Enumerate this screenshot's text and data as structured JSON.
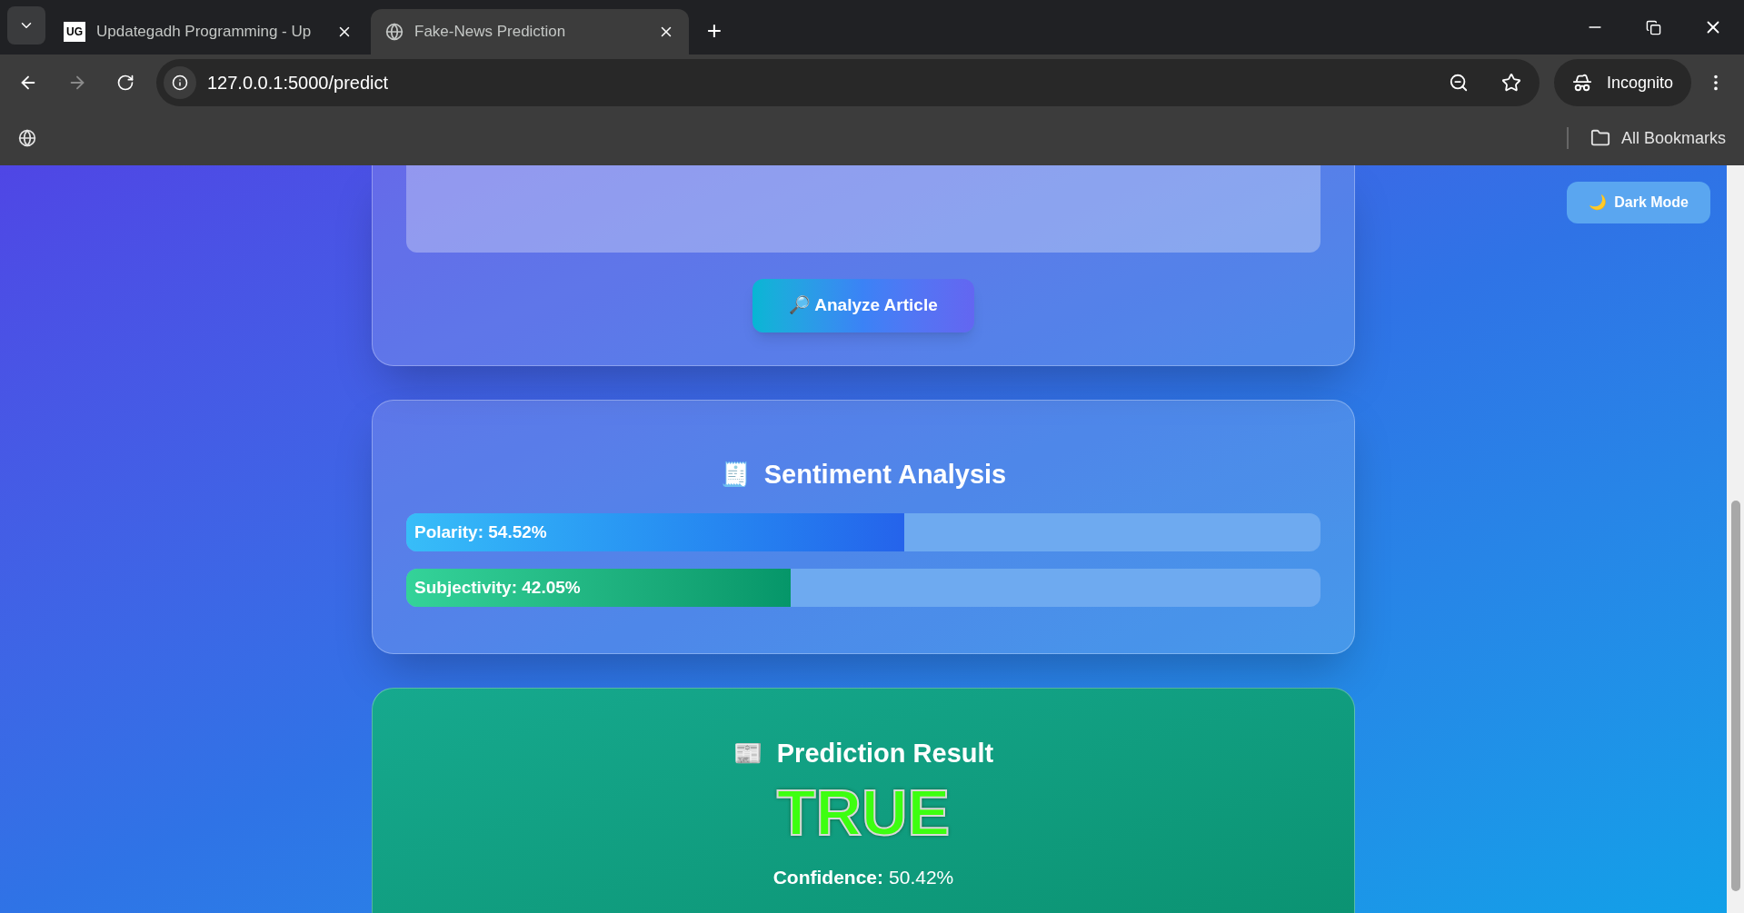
{
  "browser": {
    "tabs": [
      {
        "title": "Updategadh Programming - Up",
        "kind": "logo",
        "logo_text": "UG",
        "selected": false
      },
      {
        "title": "Fake-News Prediction",
        "kind": "globe",
        "selected": true
      }
    ],
    "new_tab": "+",
    "address": "127.0.0.1:5000/predict",
    "profile": "Incognito",
    "bookmarks": "All Bookmarks"
  },
  "dark_mode_button": {
    "icon": "🌙",
    "label": "Dark Mode"
  },
  "analyze_button": {
    "icon": "🔎",
    "label": "Analyze Article"
  },
  "sentiment": {
    "icon": "🧾",
    "title": "Sentiment Analysis",
    "bars": [
      {
        "label": "Polarity: 54.52%",
        "level": 0.5452,
        "kind": "blue"
      },
      {
        "label": "Subjectivity: 42.05%",
        "level": 0.4205,
        "kind": "green"
      }
    ]
  },
  "prediction": {
    "icon": "📰",
    "title": "Prediction Result",
    "verdict": "TRUE",
    "is_true": true,
    "confidence_label": "Confidence:",
    "confidence_value": "50.42%"
  }
}
